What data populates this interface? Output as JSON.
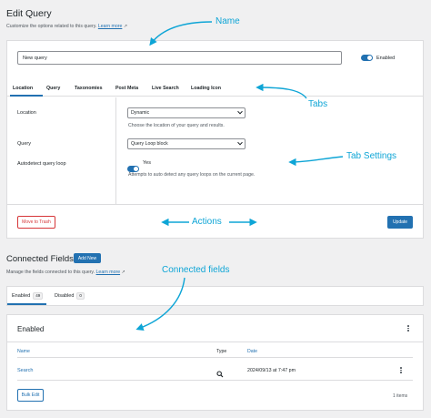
{
  "page": {
    "title": "Edit Query",
    "description": "Customize the options related to this query.",
    "learn_more": "Learn more"
  },
  "name_field": {
    "value": "New query"
  },
  "enabled_toggle": {
    "label": "Enabled",
    "state": true
  },
  "tabs": [
    {
      "label": "Location",
      "active": true
    },
    {
      "label": "Query"
    },
    {
      "label": "Taxonomies"
    },
    {
      "label": "Post Meta"
    },
    {
      "label": "Live Search"
    },
    {
      "label": "Loading Icon"
    }
  ],
  "settings": {
    "location": {
      "label": "Location",
      "value": "Dynamic",
      "help": "Choose the location of your query and results."
    },
    "query": {
      "label": "Query",
      "value": "Query Loop block"
    },
    "autodetect": {
      "label": "Autodetect query loop",
      "toggle_label": "Yes",
      "state": true,
      "help": "Attempts to auto detect any query loops on the current page."
    }
  },
  "actions": {
    "trash": "Move to Trash",
    "update": "Update"
  },
  "connected": {
    "title": "Connected Fields",
    "add_new": "Add New",
    "description": "Manage the fields connected to this query.",
    "learn_more": "Learn more",
    "tabs": [
      {
        "label": "Enabled",
        "count": "49",
        "active": true
      },
      {
        "label": "Disabled",
        "count": "0"
      }
    ],
    "panel_title": "Enabled",
    "columns": {
      "name": "Name",
      "type": "Type",
      "date": "Date"
    },
    "rows": [
      {
        "name": "Search",
        "type_icon": "search-icon",
        "date": "2024/09/13 at 7:47 pm"
      }
    ],
    "bulk_edit": "Bulk Edit",
    "items_count": "1 items"
  },
  "annotations": {
    "name": "Name",
    "tabs": "Tabs",
    "tab_settings": "Tab Settings",
    "actions": "Actions",
    "connected_fields": "Connected fields"
  },
  "colors": {
    "accent": "#2271b1",
    "annotation": "#0ea5d6",
    "danger": "#d63638"
  }
}
